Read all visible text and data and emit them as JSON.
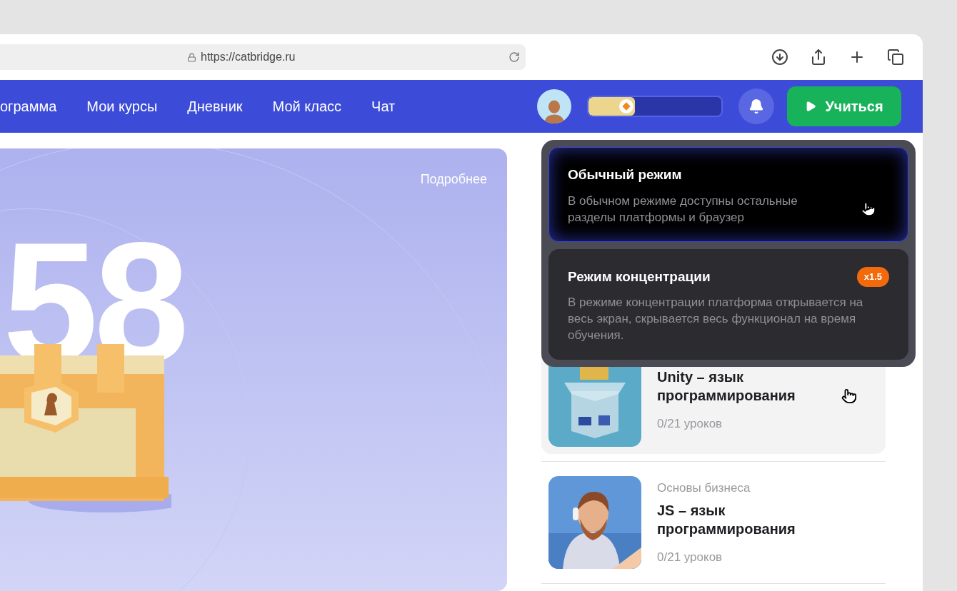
{
  "browser": {
    "url": "https://catbridge.ru"
  },
  "nav": {
    "items": [
      {
        "label": "ограмма"
      },
      {
        "label": "Мои курсы"
      },
      {
        "label": "Дневник"
      },
      {
        "label": "Мой класс"
      },
      {
        "label": "Чат"
      }
    ],
    "progress": {
      "level": 0.35
    },
    "learn_button": "Учиться"
  },
  "hero": {
    "link": "Подробнее",
    "number": "58"
  },
  "mode_menu": {
    "options": [
      {
        "title": "Обычный режим",
        "description": "В обычном режиме доступны остальные разделы платформы и браузер",
        "selected": true
      },
      {
        "title": "Режим концентрации",
        "description": "В режиме концентрации платформа открывается на весь экран, скрывается весь функционал на время обучения.",
        "badge": "x1.5",
        "selected": false
      }
    ]
  },
  "courses": [
    {
      "title": "Unity – язык программирования",
      "lessons": "0/21 уроков",
      "hovered": true
    },
    {
      "category": "Основы бизнеса",
      "title": "JS – язык программирования",
      "lessons": "0/21 уроков",
      "hovered": false
    }
  ]
}
